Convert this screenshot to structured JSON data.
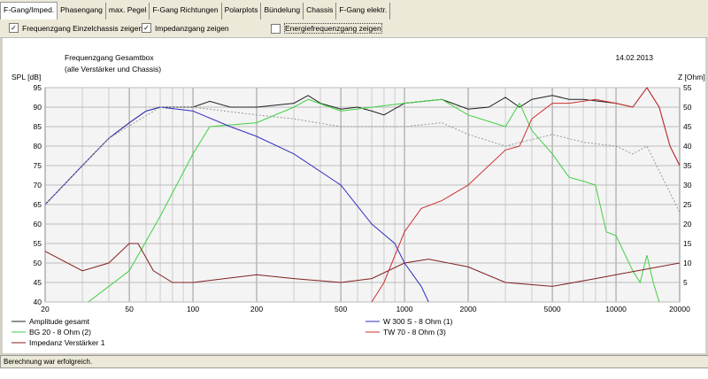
{
  "tabs": [
    "F-Gang/Imped.",
    "Phasengang",
    "max. Pegel",
    "F-Gang Richtungen",
    "Polarplots",
    "Bündelung",
    "Chassis",
    "F-Gang elektr."
  ],
  "options": [
    {
      "label": "Frequenzgang Einzelchassis zeigen",
      "checked": true
    },
    {
      "label": "Impedanzgang zeigen",
      "checked": true
    },
    {
      "label": "Energiefrequenzgang zeigen",
      "checked": false
    }
  ],
  "status": "Berechnung war erfolgreich.",
  "chart_data": {
    "type": "line",
    "title": "Frequenzgang Gesamtbox",
    "subtitle": "(alle Verstärker und Chassis)",
    "date": "14.02.2013",
    "ylabel": "SPL [dB]",
    "y2label": "Z [Ohm]",
    "xscale": "log",
    "xlim": [
      20,
      20000
    ],
    "ylim": [
      40,
      95
    ],
    "y2lim": [
      0,
      55
    ],
    "xticks": [
      20,
      50,
      100,
      200,
      500,
      1000,
      2000,
      5000,
      10000,
      20000
    ],
    "yticks": [
      40,
      45,
      50,
      55,
      60,
      65,
      70,
      75,
      80,
      85,
      90,
      95
    ],
    "y2ticks": [
      5,
      10,
      15,
      20,
      25,
      30,
      35,
      40,
      45,
      50,
      55
    ],
    "grid": true,
    "series": [
      {
        "name": "Amplitude gesamt",
        "color": "#202020",
        "axis": "left",
        "points": [
          [
            20,
            65
          ],
          [
            30,
            75
          ],
          [
            40,
            82
          ],
          [
            50,
            86
          ],
          [
            60,
            89
          ],
          [
            70,
            90
          ],
          [
            100,
            90
          ],
          [
            120,
            91.5
          ],
          [
            150,
            90
          ],
          [
            200,
            90
          ],
          [
            300,
            91
          ],
          [
            350,
            93
          ],
          [
            400,
            91
          ],
          [
            500,
            89.5
          ],
          [
            600,
            90
          ],
          [
            700,
            89
          ],
          [
            800,
            88
          ],
          [
            1000,
            91
          ],
          [
            1500,
            92
          ],
          [
            2000,
            89.5
          ],
          [
            2500,
            90
          ],
          [
            3000,
            92.5
          ],
          [
            3500,
            90
          ],
          [
            4000,
            92
          ],
          [
            5000,
            93
          ],
          [
            6000,
            92
          ],
          [
            7000,
            92
          ],
          [
            10000,
            91
          ],
          [
            12000,
            90
          ],
          [
            14000,
            95
          ],
          [
            16000,
            90
          ],
          [
            18000,
            80
          ],
          [
            20000,
            75
          ]
        ]
      },
      {
        "name": "BG 20 - 8 Ohm      (2)",
        "color": "#40d040",
        "axis": "left",
        "points": [
          [
            32,
            40
          ],
          [
            50,
            48
          ],
          [
            70,
            62
          ],
          [
            100,
            78
          ],
          [
            120,
            85
          ],
          [
            200,
            86
          ],
          [
            300,
            90
          ],
          [
            350,
            92
          ],
          [
            500,
            89
          ],
          [
            1000,
            91
          ],
          [
            1500,
            92
          ],
          [
            2000,
            88
          ],
          [
            3000,
            85
          ],
          [
            3500,
            91
          ],
          [
            4000,
            84
          ],
          [
            5000,
            78
          ],
          [
            6000,
            72
          ],
          [
            7000,
            71
          ],
          [
            8000,
            70
          ],
          [
            9000,
            58
          ],
          [
            10000,
            57
          ],
          [
            12000,
            48
          ],
          [
            13000,
            45
          ],
          [
            14000,
            52
          ],
          [
            15000,
            45
          ],
          [
            16000,
            40
          ]
        ]
      },
      {
        "name": "Impedanz Verstärker 1",
        "color": "#802020",
        "axis": "right",
        "points": [
          [
            20,
            13
          ],
          [
            30,
            8
          ],
          [
            40,
            10
          ],
          [
            50,
            15
          ],
          [
            55,
            15
          ],
          [
            65,
            8
          ],
          [
            80,
            5
          ],
          [
            100,
            5
          ],
          [
            200,
            7
          ],
          [
            300,
            6
          ],
          [
            500,
            5
          ],
          [
            700,
            6
          ],
          [
            1000,
            10
          ],
          [
            1300,
            11
          ],
          [
            2000,
            9
          ],
          [
            3000,
            5
          ],
          [
            5000,
            4
          ],
          [
            8000,
            6
          ],
          [
            10000,
            7
          ],
          [
            20000,
            10
          ]
        ]
      },
      {
        "name": "W 300 S - 8 Ohm (1)",
        "color": "#3030c0",
        "axis": "left",
        "points": [
          [
            20,
            65
          ],
          [
            30,
            75
          ],
          [
            40,
            82
          ],
          [
            50,
            86
          ],
          [
            60,
            89
          ],
          [
            70,
            90
          ],
          [
            100,
            89
          ],
          [
            150,
            85
          ],
          [
            200,
            82.5
          ],
          [
            300,
            78
          ],
          [
            500,
            70
          ],
          [
            700,
            60
          ],
          [
            900,
            55
          ],
          [
            1000,
            50
          ],
          [
            1200,
            44
          ],
          [
            1300,
            40
          ]
        ]
      },
      {
        "name": "TW 70 - 8 Ohm (3)",
        "color": "#d03030",
        "axis": "left",
        "points": [
          [
            700,
            40
          ],
          [
            800,
            45
          ],
          [
            1000,
            58
          ],
          [
            1200,
            64
          ],
          [
            1500,
            66
          ],
          [
            2000,
            70
          ],
          [
            3000,
            79
          ],
          [
            3500,
            80
          ],
          [
            4000,
            87
          ],
          [
            5000,
            91
          ],
          [
            6000,
            91
          ],
          [
            8000,
            92
          ],
          [
            10000,
            91
          ],
          [
            12000,
            90
          ],
          [
            14000,
            95
          ],
          [
            16000,
            90
          ],
          [
            18000,
            80
          ],
          [
            20000,
            75
          ]
        ]
      },
      {
        "name": "",
        "color": "#999999",
        "axis": "left",
        "dashed": true,
        "points": [
          [
            20,
            65
          ],
          [
            40,
            82
          ],
          [
            70,
            90
          ],
          [
            100,
            90
          ],
          [
            200,
            88
          ],
          [
            300,
            87
          ],
          [
            500,
            85
          ],
          [
            1000,
            85
          ],
          [
            1500,
            86
          ],
          [
            2000,
            83
          ],
          [
            3000,
            80
          ],
          [
            5000,
            83
          ],
          [
            7000,
            81
          ],
          [
            10000,
            80
          ],
          [
            12000,
            78
          ],
          [
            14000,
            80
          ],
          [
            20000,
            63
          ]
        ]
      }
    ]
  }
}
